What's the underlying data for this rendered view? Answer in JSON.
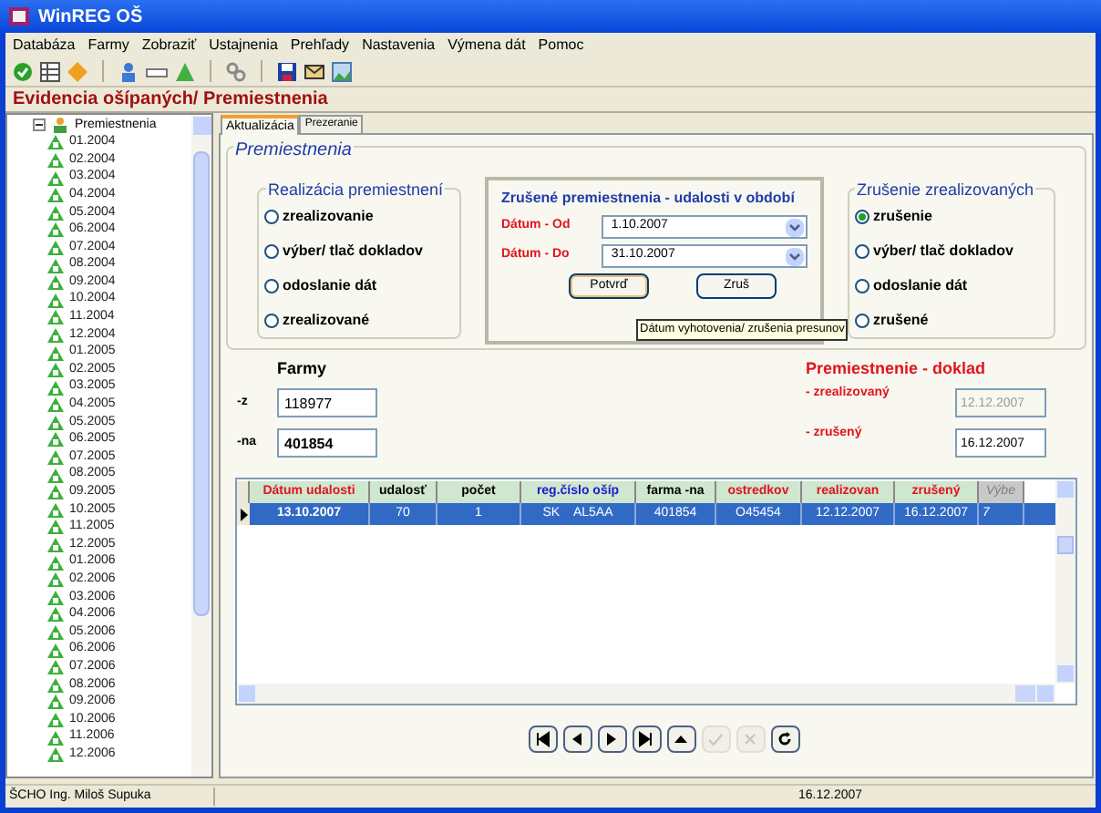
{
  "window": {
    "title": "WinREG OŠ"
  },
  "menu": [
    "Databáza",
    "Farmy",
    "Zobraziť",
    "Ustajnenia",
    "Prehľady",
    "Nastavenia",
    "Výmena dát",
    "Pomoc"
  ],
  "header": "Evidencia ošípaných/ Premiestnenia",
  "tree": {
    "label": "Premiestnenia",
    "expanded": true,
    "children": [
      {
        "label": "01.2004"
      },
      {
        "label": "02.2004"
      },
      {
        "label": "03.2004"
      },
      {
        "label": "04.2004"
      },
      {
        "label": "05.2004"
      },
      {
        "label": "06.2004"
      },
      {
        "label": "07.2004"
      },
      {
        "label": "08.2004"
      },
      {
        "label": "09.2004"
      },
      {
        "label": "10.2004"
      },
      {
        "label": "11.2004"
      },
      {
        "label": "12.2004"
      },
      {
        "label": "01.2005"
      },
      {
        "label": "02.2005"
      },
      {
        "label": "03.2005"
      },
      {
        "label": "04.2005"
      },
      {
        "label": "05.2005"
      },
      {
        "label": "06.2005"
      },
      {
        "label": "07.2005"
      },
      {
        "label": "08.2005"
      },
      {
        "label": "09.2005"
      },
      {
        "label": "10.2005"
      },
      {
        "label": "11.2005"
      },
      {
        "label": "12.2005"
      },
      {
        "label": "01.2006"
      },
      {
        "label": "02.2006"
      },
      {
        "label": "03.2006"
      },
      {
        "label": "04.2006"
      },
      {
        "label": "05.2006"
      },
      {
        "label": "06.2006"
      },
      {
        "label": "07.2006"
      },
      {
        "label": "08.2006"
      },
      {
        "label": "09.2006"
      },
      {
        "label": "10.2006"
      },
      {
        "label": "11.2006"
      },
      {
        "label": "12.2006"
      }
    ]
  },
  "tabs": [
    {
      "label": "Aktualizácia",
      "selected": true
    },
    {
      "label": "Prezeranie",
      "selected": false
    }
  ],
  "panel_title": "Premiestnenia",
  "realization": {
    "title": "Realizácia premiestnení",
    "options": [
      {
        "label": "zrealizovanie",
        "selected": false
      },
      {
        "label": "výber/ tlač dokladov",
        "selected": false
      },
      {
        "label": "odoslanie dát",
        "selected": false
      },
      {
        "label": "zrealizované",
        "selected": false
      }
    ]
  },
  "cancelled_events": {
    "title": "Zrušené premiestnenia - udalosti v období",
    "date_from": {
      "label": "Dátum - Od",
      "value": "1.10.2007"
    },
    "date_to": {
      "label": "Dátum - Do",
      "value": "31.10.2007"
    },
    "buttons": [
      "Potvrď",
      "Zruš"
    ]
  },
  "tooltip": "Dátum vyhotovenia/ zrušenia presunov",
  "cancellation": {
    "title": "Zrušenie zrealizovaných",
    "options": [
      {
        "label": "zrušenie",
        "selected": true
      },
      {
        "label": "výber/ tlač dokladov",
        "selected": false
      },
      {
        "label": "odoslanie dát",
        "selected": false
      },
      {
        "label": "zrušené",
        "selected": false
      }
    ]
  },
  "farms": {
    "title": "Farmy",
    "from": {
      "label": "-z",
      "value": "118977"
    },
    "to": {
      "label": "-na",
      "value": "401854"
    }
  },
  "document": {
    "title": "Premiestnenie - doklad",
    "realized": {
      "label": "- zrealizovaný",
      "value": "12.12.2007",
      "disabled": true
    },
    "cancelled": {
      "label": "- zrušený",
      "value": "16.12.2007",
      "disabled": false
    }
  },
  "table": {
    "columns": [
      {
        "label": "Dátum udalosti",
        "color": "#e0141e"
      },
      {
        "label": "udalosť",
        "color": "#000000"
      },
      {
        "label": "počet",
        "color": "#000000"
      },
      {
        "label": "reg.číslo ošíp",
        "color": "#1c1cd0"
      },
      {
        "label": "farma -na",
        "color": "#000000"
      },
      {
        "label": "ostredkov",
        "color": "#e0141e"
      },
      {
        "label": "realizovan",
        "color": "#e0141e"
      },
      {
        "label": "zrušený",
        "color": "#e0141e"
      },
      {
        "label": "Výbe",
        "color": "#808080"
      }
    ],
    "rows": [
      {
        "selected": true,
        "cells": [
          "13.10.2007",
          "70",
          "1",
          "SK    AL5AA",
          "401854",
          "O45454",
          "12.12.2007",
          "16.12.2007",
          "7"
        ]
      }
    ]
  },
  "nav": [
    {
      "kind": "first",
      "disabled": false
    },
    {
      "kind": "prev",
      "disabled": false
    },
    {
      "kind": "next",
      "disabled": false
    },
    {
      "kind": "last",
      "disabled": false
    },
    {
      "kind": "up",
      "disabled": false
    },
    {
      "kind": "check",
      "disabled": true
    },
    {
      "kind": "cancel",
      "disabled": true
    },
    {
      "kind": "refresh",
      "disabled": false
    }
  ],
  "status_bar": {
    "user": "ŠCHO Ing. Miloš Supuka",
    "date": "16.12.2007"
  }
}
